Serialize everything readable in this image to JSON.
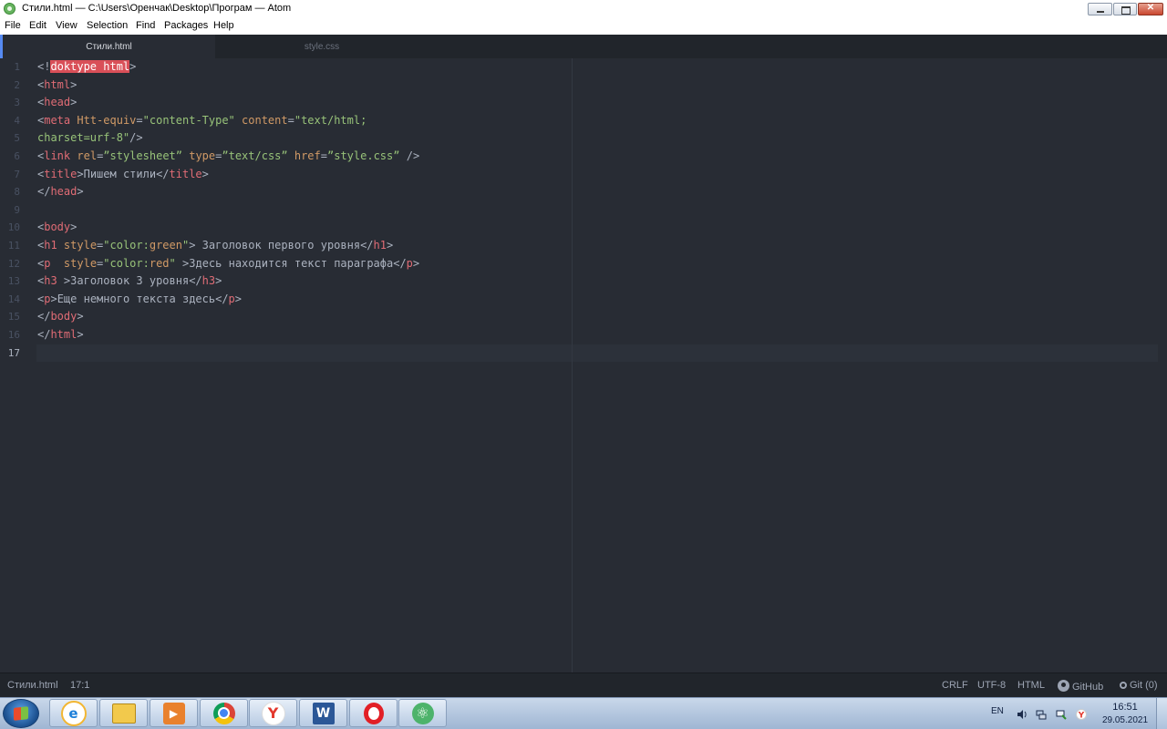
{
  "window": {
    "title": "Стили.html — C:\\Users\\Оренчак\\Desktop\\Програм — Atom"
  },
  "menu": [
    "File",
    "Edit",
    "View",
    "Selection",
    "Find",
    "Packages",
    "Help"
  ],
  "tabs": [
    {
      "label": "Стили.html",
      "active": true
    },
    {
      "label": "style.css",
      "active": false
    }
  ],
  "editor": {
    "line_numbers": [
      "1",
      "2",
      "3",
      "4",
      "5",
      "6",
      "7",
      "8",
      "9",
      "10",
      "11",
      "12",
      "13",
      "14",
      "15",
      "16",
      "17"
    ],
    "current_line": "17",
    "lines": [
      [
        [
          "pun",
          "<!"
        ],
        [
          "hl",
          "doktype html"
        ],
        [
          "pun",
          ">"
        ]
      ],
      [
        [
          "pun",
          "<"
        ],
        [
          "tag",
          "html"
        ],
        [
          "pun",
          ">"
        ]
      ],
      [
        [
          "pun",
          "<"
        ],
        [
          "tag",
          "head"
        ],
        [
          "pun",
          ">"
        ]
      ],
      [
        [
          "pun",
          "<"
        ],
        [
          "tag",
          "meta"
        ],
        [
          "txt",
          " "
        ],
        [
          "attr",
          "Htt-equiv"
        ],
        [
          "pun",
          "="
        ],
        [
          "str",
          "\"content-Type\""
        ],
        [
          "txt",
          " "
        ],
        [
          "attr",
          "content"
        ],
        [
          "pun",
          "="
        ],
        [
          "str",
          "\"text/html;"
        ]
      ],
      [
        [
          "str",
          "charset=urf-8\""
        ],
        [
          "pun",
          "/>"
        ]
      ],
      [
        [
          "pun",
          "<"
        ],
        [
          "tag",
          "link"
        ],
        [
          "txt",
          " "
        ],
        [
          "attr",
          "rel"
        ],
        [
          "pun",
          "="
        ],
        [
          "str",
          "”stylesheet”"
        ],
        [
          "txt",
          " "
        ],
        [
          "attr",
          "type"
        ],
        [
          "pun",
          "="
        ],
        [
          "str",
          "”text/css”"
        ],
        [
          "txt",
          " "
        ],
        [
          "attr",
          "href"
        ],
        [
          "pun",
          "="
        ],
        [
          "str",
          "”style.css”"
        ],
        [
          "txt",
          " "
        ],
        [
          "pun",
          "/>"
        ]
      ],
      [
        [
          "pun",
          "<"
        ],
        [
          "tag",
          "title"
        ],
        [
          "pun",
          ">"
        ],
        [
          "txt",
          "Пишем стили"
        ],
        [
          "pun",
          "</"
        ],
        [
          "tag",
          "title"
        ],
        [
          "pun",
          ">"
        ]
      ],
      [
        [
          "pun",
          "</"
        ],
        [
          "tag",
          "head"
        ],
        [
          "pun",
          ">"
        ]
      ],
      [],
      [
        [
          "pun",
          "<"
        ],
        [
          "tag",
          "body"
        ],
        [
          "pun",
          ">"
        ]
      ],
      [
        [
          "pun",
          "<"
        ],
        [
          "tag",
          "h1"
        ],
        [
          "txt",
          " "
        ],
        [
          "attr",
          "style"
        ],
        [
          "pun",
          "="
        ],
        [
          "str",
          "\"color:"
        ],
        [
          "attr",
          "green"
        ],
        [
          "str",
          "\""
        ],
        [
          "pun",
          ">"
        ],
        [
          "txt",
          " Заголовок первого уровня"
        ],
        [
          "pun",
          "</"
        ],
        [
          "tag",
          "h1"
        ],
        [
          "pun",
          ">"
        ]
      ],
      [
        [
          "pun",
          "<"
        ],
        [
          "tag",
          "p"
        ],
        [
          "txt",
          "  "
        ],
        [
          "attr",
          "style"
        ],
        [
          "pun",
          "="
        ],
        [
          "str",
          "\"color:"
        ],
        [
          "attr",
          "red"
        ],
        [
          "str",
          "\""
        ],
        [
          "txt",
          " "
        ],
        [
          "pun",
          ">"
        ],
        [
          "txt",
          "Здесь находится текст параграфа"
        ],
        [
          "pun",
          "</"
        ],
        [
          "tag",
          "p"
        ],
        [
          "pun",
          ">"
        ]
      ],
      [
        [
          "pun",
          "<"
        ],
        [
          "tag",
          "h3"
        ],
        [
          "txt",
          " "
        ],
        [
          "pun",
          ">"
        ],
        [
          "txt",
          "Заголовок 3 уровня"
        ],
        [
          "pun",
          "</"
        ],
        [
          "tag",
          "h3"
        ],
        [
          "pun",
          ">"
        ]
      ],
      [
        [
          "pun",
          "<"
        ],
        [
          "tag",
          "p"
        ],
        [
          "pun",
          ">"
        ],
        [
          "txt",
          "Еще немного текста здесь"
        ],
        [
          "pun",
          "</"
        ],
        [
          "tag",
          "p"
        ],
        [
          "pun",
          ">"
        ]
      ],
      [
        [
          "pun",
          "</"
        ],
        [
          "tag",
          "body"
        ],
        [
          "pun",
          ">"
        ]
      ],
      [
        [
          "pun",
          "</"
        ],
        [
          "tag",
          "html"
        ],
        [
          "pun",
          ">"
        ]
      ],
      []
    ]
  },
  "status": {
    "file": "Стили.html",
    "cursor": "17:1",
    "line_ending": "CRLF",
    "encoding": "UTF-8",
    "grammar": "HTML",
    "github": "GitHub",
    "git": "Git (0)"
  },
  "taskbar": {
    "apps": [
      "internet-explorer",
      "file-explorer",
      "media-player",
      "chrome",
      "yandex-browser",
      "word",
      "opera",
      "atom"
    ],
    "language": "EN",
    "time": "16:51",
    "date": "29.05.2021"
  },
  "colors": {
    "editor_bg": "#282c34",
    "tag": "#e06c75",
    "attribute": "#d19a66",
    "string": "#98c379",
    "highlight": "#d94f58"
  }
}
